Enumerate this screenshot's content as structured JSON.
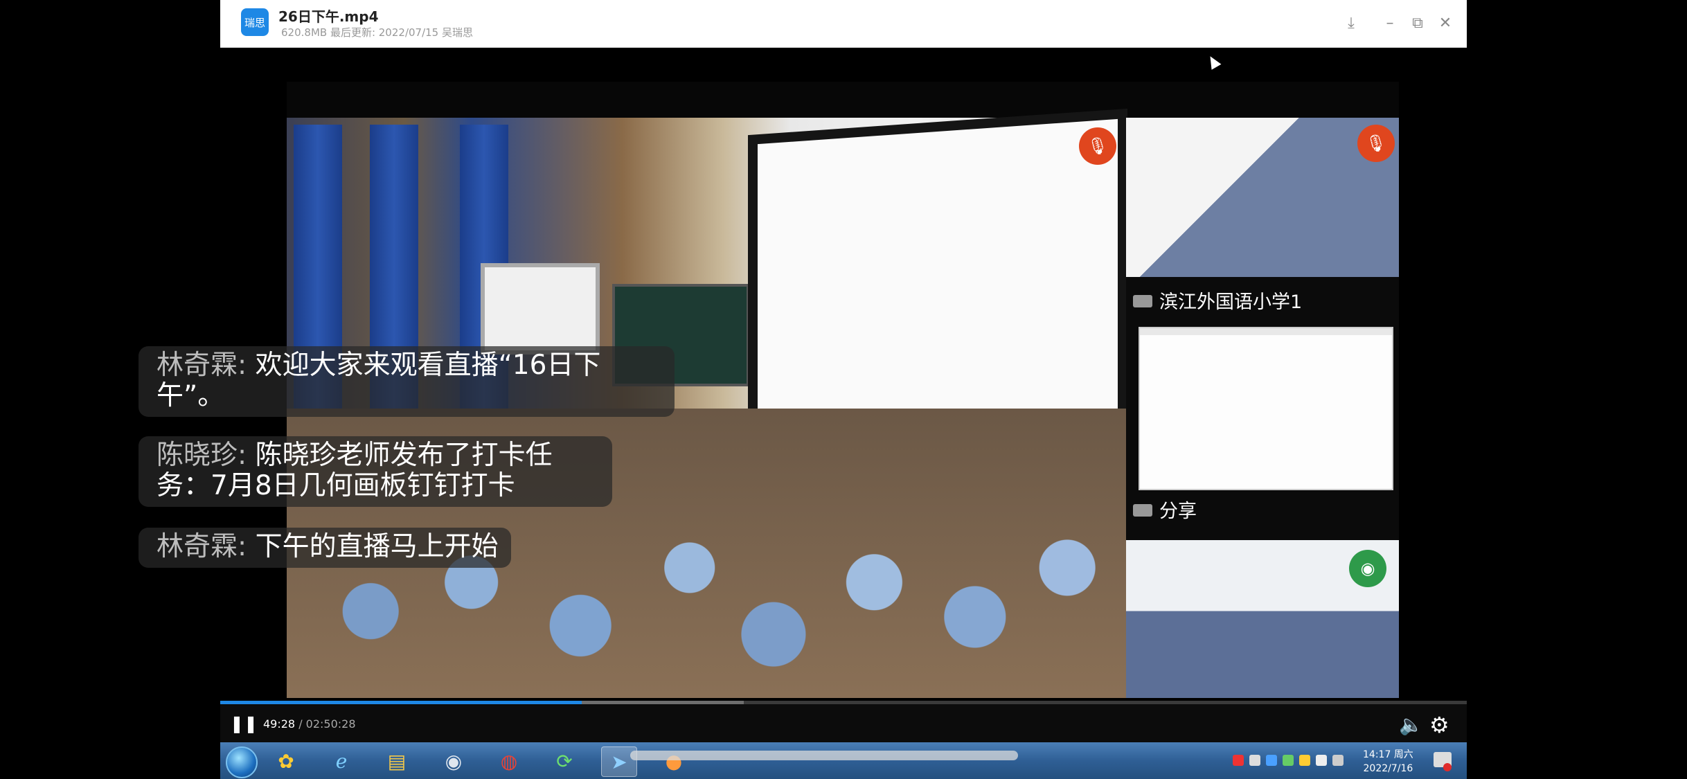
{
  "window": {
    "app_logo_text": "瑞思",
    "file_name": "26日下午.mp4",
    "file_meta": "620.8MB  最后更新: 2022/07/15 吴瑞思",
    "buttons": {
      "download": "⤓",
      "minimize": "–",
      "restore": "⧉",
      "close": "✕"
    }
  },
  "side_panel": {
    "label_1": "滨江外国语小学1",
    "label_2": "分享"
  },
  "chat": [
    {
      "name": "林奇霖",
      "sep": ": ",
      "text": "欢迎大家来观看直播“16日下午”。"
    },
    {
      "name": "陈晓珍",
      "sep": ": ",
      "text": "陈晓珍老师发布了打卡任务：7月8日几何画板钉钉打卡"
    },
    {
      "name": "林奇霖",
      "sep": ": ",
      "text": "下午的直播马上开始"
    }
  ],
  "player": {
    "current_time": "49:28",
    "separator": " / ",
    "duration": "02:50:28",
    "progress_fraction": 0.29,
    "buffered_fraction": 0.42
  },
  "taskbar": {
    "clock_time": "14:17 周六",
    "clock_date": "2022/7/16"
  },
  "colors": {
    "accent": "#1e88e5",
    "mic_muted": "#e0461e",
    "camera_active": "#2e9a4a"
  }
}
